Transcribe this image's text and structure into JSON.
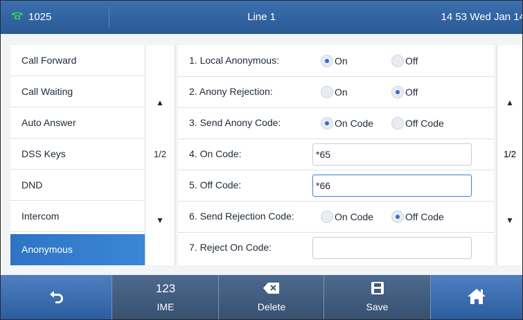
{
  "status_bar": {
    "extension": "1025",
    "account": "Line 1",
    "datetime": "14 53 Wed Jan 14",
    "phone_icon": "phone-handset-icon"
  },
  "menu": {
    "items": [
      {
        "label": "Call Forward"
      },
      {
        "label": "Call Waiting"
      },
      {
        "label": "Auto Answer"
      },
      {
        "label": "DSS Keys"
      },
      {
        "label": "DND"
      },
      {
        "label": "Intercom"
      },
      {
        "label": "Anonymous"
      }
    ],
    "active_index": 6,
    "page": "1/2"
  },
  "settings": {
    "local_anonymous": {
      "label": "1. Local Anonymous:",
      "options": [
        "On",
        "Off"
      ],
      "selected": "On"
    },
    "anony_rejection": {
      "label": "2. Anony Rejection:",
      "options": [
        "On",
        "Off"
      ],
      "selected": "Off"
    },
    "send_anony_code": {
      "label": "3. Send Anony Code:",
      "options": [
        "On Code",
        "Off Code"
      ],
      "selected": "On Code"
    },
    "on_code": {
      "label": "4. On Code:",
      "value": "*65"
    },
    "off_code": {
      "label": "5. Off Code:",
      "value": "*66"
    },
    "send_rejection_code": {
      "label": "6. Send Rejection Code:",
      "options": [
        "On Code",
        "Off Code"
      ],
      "selected": "Off Code"
    },
    "reject_on_code": {
      "label": "7. Reject On Code:",
      "value": ""
    },
    "page": "1/2"
  },
  "softkeys": {
    "back_icon": "back-arrow-icon",
    "ime_top": "123",
    "ime_label": "IME",
    "delete_label": "Delete",
    "delete_icon": "backspace-icon",
    "save_label": "Save",
    "save_icon": "floppy-disk-icon",
    "home_icon": "home-icon"
  },
  "colors": {
    "accent": "#2f74c4",
    "status_bar": "#2a5a96",
    "radio_selected": "#2f6fd0"
  }
}
